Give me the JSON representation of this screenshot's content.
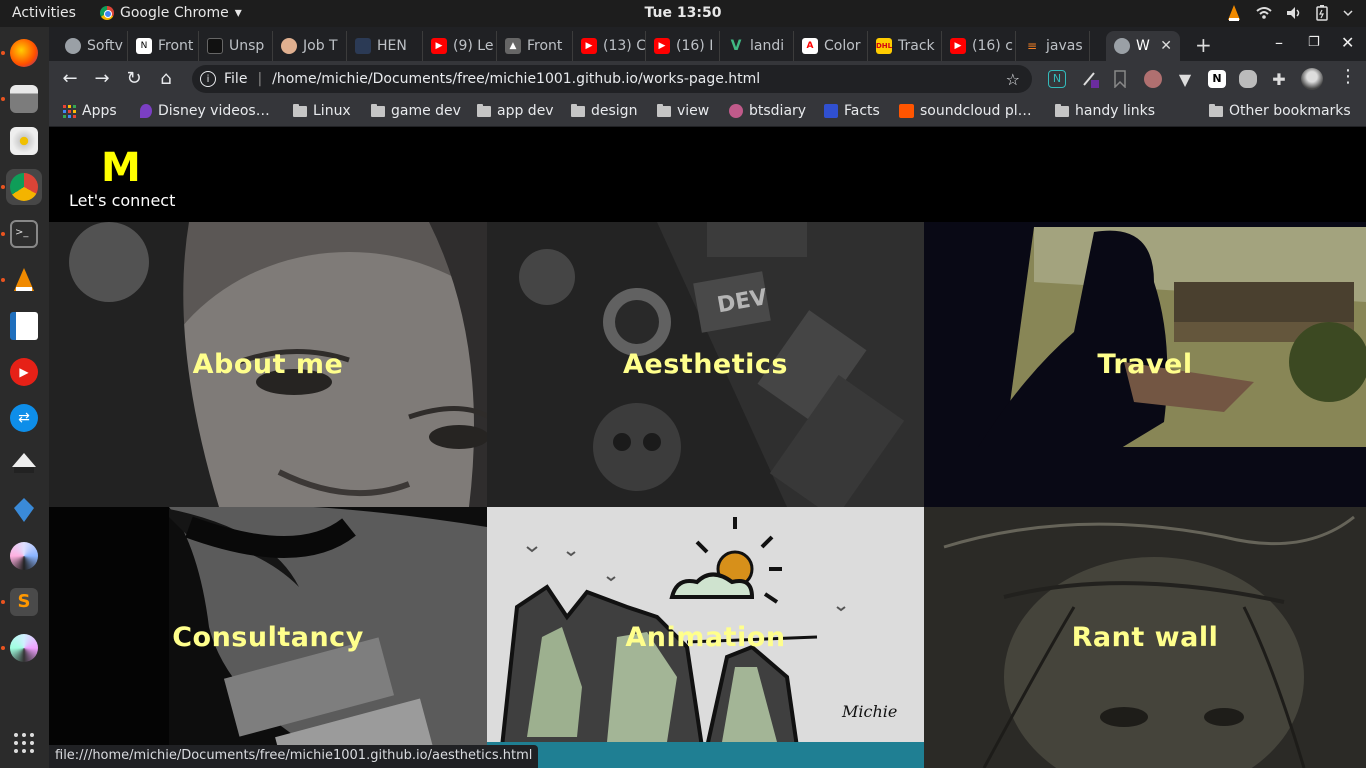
{
  "topbar": {
    "activities": "Activities",
    "app_name": "Google Chrome",
    "app_menu_arrow": "▾",
    "clock": "Tue 13:50"
  },
  "dock": {
    "items": [
      "firefox-icon",
      "files-icon",
      "disks-icon",
      "chrome-icon",
      "terminal-icon",
      "vlc-icon",
      "writer-icon",
      "youtube-icon",
      "teamviewer-icon",
      "inkscape-icon",
      "crystal-icon",
      "shotwell-icon",
      "sublime-icon",
      "blender-icon"
    ]
  },
  "tabs": [
    {
      "title": "Softv",
      "favicon_color": "#9aa0a6"
    },
    {
      "title": "Front",
      "favicon_color": "#ffffff"
    },
    {
      "title": "Unsp",
      "favicon_color": "#222222"
    },
    {
      "title": "Job T",
      "favicon_color": "#e0b090"
    },
    {
      "title": "HEN",
      "favicon_color": "#2b3a55"
    },
    {
      "title": "(9) Le",
      "favicon_color": "#ff0000"
    },
    {
      "title": "Front",
      "favicon_color": "#888888"
    },
    {
      "title": "(13) C",
      "favicon_color": "#ff0000"
    },
    {
      "title": "(16) I",
      "favicon_color": "#ff0000"
    },
    {
      "title": "landi",
      "favicon_color": "#41b883"
    },
    {
      "title": "Color",
      "favicon_color": "#ff0000"
    },
    {
      "title": "Track",
      "favicon_color": "#ffcc00"
    },
    {
      "title": "(16) c",
      "favicon_color": "#ff0000"
    },
    {
      "title": "javas",
      "favicon_color": "#f48024"
    },
    {
      "title": "W",
      "favicon_color": "#9aa0a6"
    }
  ],
  "toolbar": {
    "back": "←",
    "forward": "→",
    "reload": "↻",
    "home": "⌂",
    "scheme_label": "File",
    "url": "/home/michie/Documents/free/michie1001.github.io/works-page.html",
    "star": "☆"
  },
  "bookmarks": [
    {
      "label": "Apps",
      "kind": "apps"
    },
    {
      "label": "Disney videos…",
      "kind": "site"
    },
    {
      "label": "Linux",
      "kind": "folder"
    },
    {
      "label": "game dev",
      "kind": "folder"
    },
    {
      "label": "app dev",
      "kind": "folder"
    },
    {
      "label": "design",
      "kind": "folder"
    },
    {
      "label": "view",
      "kind": "folder"
    },
    {
      "label": "btsdiary",
      "kind": "site"
    },
    {
      "label": "Facts",
      "kind": "site"
    },
    {
      "label": "soundcloud pl…",
      "kind": "site"
    },
    {
      "label": "handy links",
      "kind": "folder"
    },
    {
      "label": "Other bookmarks",
      "kind": "folder"
    }
  ],
  "site": {
    "logo": "M",
    "connect": "Let's connect",
    "tiles": [
      {
        "label": "About me"
      },
      {
        "label": "Aesthetics"
      },
      {
        "label": "Travel"
      },
      {
        "label": "Consultancy"
      },
      {
        "label": "Animation"
      },
      {
        "label": "Rant wall"
      }
    ]
  },
  "statusbar": {
    "link": "file:///home/michie/Documents/free/michie1001.github.io/aesthetics.html"
  },
  "colors": {
    "logo": "#ffff00",
    "tile_label": "#ffff8c"
  }
}
